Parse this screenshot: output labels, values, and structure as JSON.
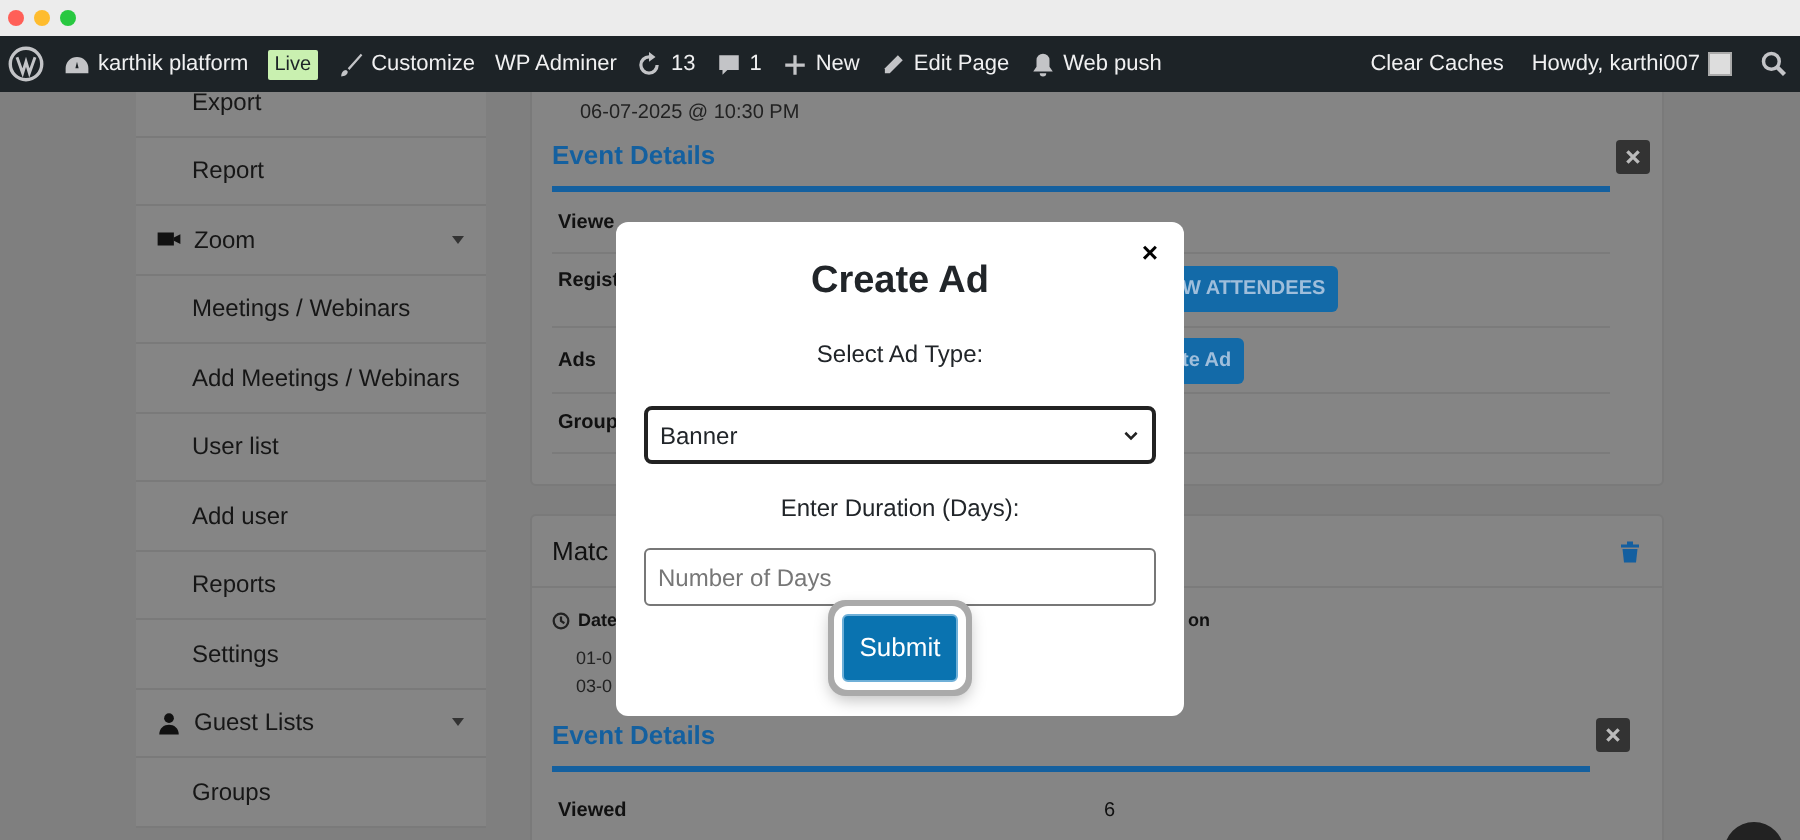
{
  "browser": {
    "dots": [
      {
        "color": "#ff5f57"
      },
      {
        "color": "#febc2e"
      },
      {
        "color": "#28c840"
      }
    ]
  },
  "admin_bar": {
    "left": [
      {
        "kind": "logo"
      },
      {
        "kind": "item",
        "label": "karthik platform",
        "badge": "Live"
      },
      {
        "kind": "item",
        "label": "Customize"
      },
      {
        "kind": "item",
        "label": "WP Adminer"
      },
      {
        "kind": "item",
        "label": "13"
      },
      {
        "kind": "item",
        "label": "1"
      },
      {
        "kind": "item",
        "label": "New"
      },
      {
        "kind": "item",
        "label": "Edit Page"
      },
      {
        "kind": "item",
        "label": "Web push"
      }
    ],
    "right": [
      {
        "kind": "item",
        "label": "Clear Caches"
      },
      {
        "kind": "account",
        "label": "Howdy, karthi007"
      },
      {
        "kind": "search"
      }
    ]
  },
  "sidebar": {
    "items": [
      {
        "label": "Export"
      },
      {
        "label": "Report"
      },
      {
        "label": "Zoom",
        "children": [
          {
            "label": "Meetings / Webinars"
          },
          {
            "label": "Add Meetings / Webinars"
          },
          {
            "label": "User list"
          },
          {
            "label": "Add user"
          },
          {
            "label": "Reports"
          },
          {
            "label": "Settings"
          }
        ]
      },
      {
        "label": "Guest Lists",
        "children": [
          {
            "label": "Groups"
          }
        ]
      }
    ]
  },
  "event_card": {
    "date": "06-07-2025 @ 10:30 PM",
    "section_title": "Event Details",
    "rows": [
      {
        "label": "Viewe"
      },
      {
        "label": "Regist",
        "button": "W ATTENDEES"
      },
      {
        "label": "Ads",
        "button": "te Ad"
      },
      {
        "label": "Group"
      }
    ]
  },
  "match_card": {
    "title": "Matc",
    "columns": [
      {
        "label": "Date",
        "values": [
          "01-0",
          "03-0"
        ]
      },
      {
        "label": "on"
      }
    ],
    "section_title": "Event Details",
    "rows": [
      {
        "label": "Viewed",
        "value": "6"
      }
    ]
  },
  "modal": {
    "title": "Create Ad",
    "close": "×",
    "fields": [
      {
        "kind": "select",
        "label": "Select Ad Type:",
        "value": "Banner"
      },
      {
        "kind": "input",
        "label": "Enter Duration (Days):",
        "placeholder": "Number of Days"
      }
    ],
    "submit": {
      "label": "Submit",
      "focused": true
    }
  }
}
